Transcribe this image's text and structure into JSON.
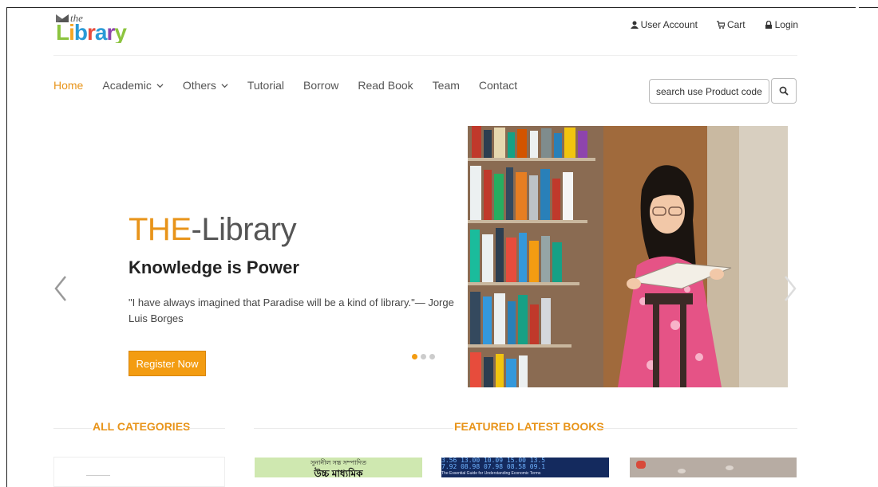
{
  "header": {
    "logo": {
      "prefix": "the",
      "word": "Library"
    },
    "links": [
      {
        "label": "User Account",
        "icon": "user-icon"
      },
      {
        "label": "Cart",
        "icon": "cart-icon"
      },
      {
        "label": "Login",
        "icon": "lock-icon"
      }
    ]
  },
  "nav": {
    "items": [
      {
        "label": "Home",
        "active": true
      },
      {
        "label": "Academic",
        "dropdown": true
      },
      {
        "label": "Others",
        "dropdown": true
      },
      {
        "label": "Tutorial"
      },
      {
        "label": "Borrow"
      },
      {
        "label": "Read Book"
      },
      {
        "label": "Team"
      },
      {
        "label": "Contact"
      }
    ],
    "search": {
      "placeholder": "search use Product code"
    }
  },
  "hero": {
    "title_accent": "THE",
    "title_rest": "-Library",
    "subtitle": "Knowledge is Power",
    "quote": "\"I have always imagined that Paradise will be a kind of library.\"— Jorge Luis Borges",
    "cta": "Register Now",
    "slides": 3,
    "active_slide": 1
  },
  "sections": {
    "categories_title": "ALL CATEGORIES",
    "featured_title": "FEATURED LATEST BOOKS"
  },
  "books": [
    {
      "text_line1": "সুনানীল সন্ত সম্পাদিত",
      "text_line2": "উচ্চ মাধ্যমিক"
    },
    {
      "ticker": "3.56  13.00  10.09  15.00  13.5",
      "ticker2": "7.92  08.98  07.98  08.58  09.1",
      "caption": "The Essential Guide for Understanding Economic Terms"
    },
    {}
  ],
  "colors": {
    "accent": "#e8941a",
    "button": "#f39c12"
  }
}
